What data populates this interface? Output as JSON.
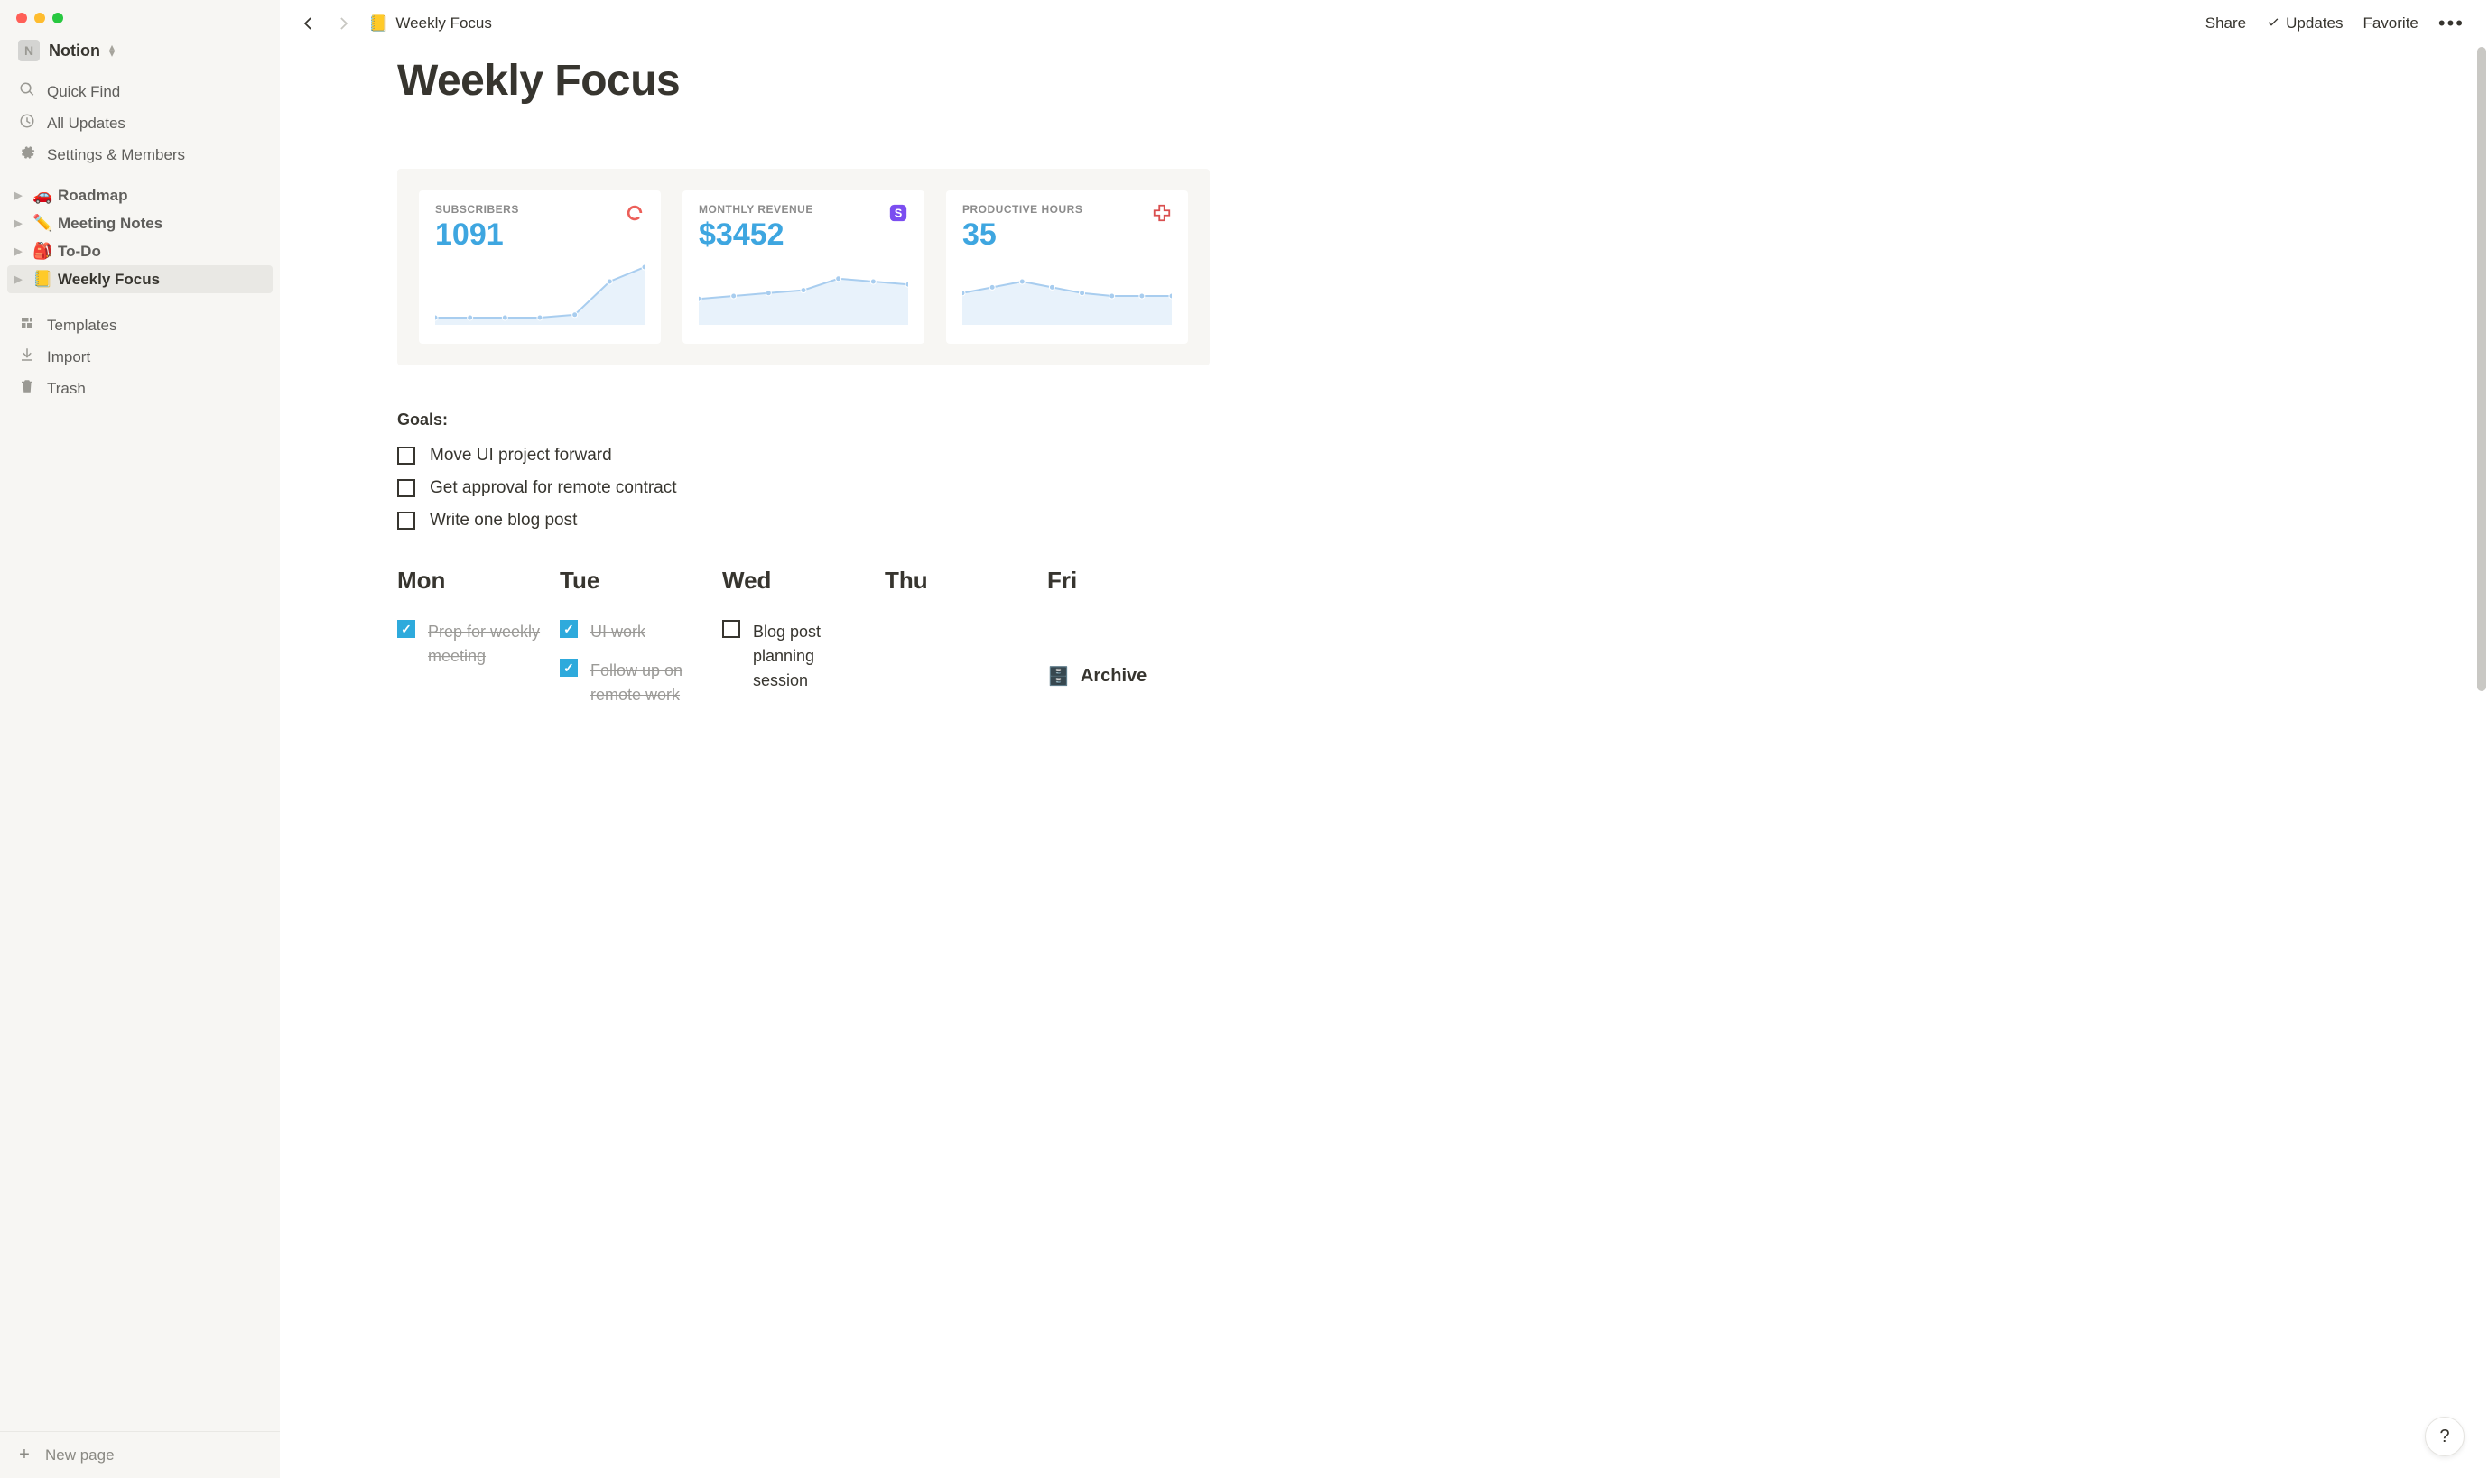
{
  "workspace": {
    "icon_letter": "N",
    "name": "Notion"
  },
  "sidebar": {
    "quick_find": "Quick Find",
    "all_updates": "All Updates",
    "settings": "Settings & Members",
    "pages": [
      {
        "emoji": "🚗",
        "label": "Roadmap"
      },
      {
        "emoji": "✏️",
        "label": "Meeting Notes"
      },
      {
        "emoji": "🎒",
        "label": "To-Do"
      },
      {
        "emoji": "📒",
        "label": "Weekly Focus"
      }
    ],
    "templates": "Templates",
    "import": "Import",
    "trash": "Trash",
    "new_page": "New page"
  },
  "topbar": {
    "breadcrumb_emoji": "📒",
    "breadcrumb_label": "Weekly Focus",
    "share": "Share",
    "updates": "Updates",
    "favorite": "Favorite"
  },
  "page": {
    "title": "Weekly Focus",
    "stats": [
      {
        "label": "SUBSCRIBERS",
        "value": "1091",
        "icon_color": "#ec5f59",
        "points": [
          5,
          5,
          5,
          5,
          7,
          30,
          40
        ]
      },
      {
        "label": "MONTHLY REVENUE",
        "value": "$3452",
        "icon_color": "#7b4ef0",
        "points": [
          18,
          20,
          22,
          24,
          32,
          30,
          28
        ]
      },
      {
        "label": "PRODUCTIVE HOURS",
        "value": "35",
        "icon_color": "#d94f4f",
        "points": [
          22,
          26,
          30,
          26,
          22,
          20,
          20,
          20
        ]
      }
    ],
    "goals_heading": "Goals:",
    "goals": [
      {
        "text": "Move UI project forward",
        "done": false
      },
      {
        "text": "Get approval for remote contract",
        "done": false
      },
      {
        "text": "Write one blog post",
        "done": false
      }
    ],
    "days": [
      {
        "name": "Mon",
        "tasks": [
          {
            "text": "Prep for weekly meeting",
            "done": true
          }
        ]
      },
      {
        "name": "Tue",
        "tasks": [
          {
            "text": "UI work",
            "done": true
          },
          {
            "text": "Follow up on remote work",
            "done": true
          }
        ]
      },
      {
        "name": "Wed",
        "tasks": [
          {
            "text": "Blog post planning session",
            "done": false
          }
        ]
      },
      {
        "name": "Thu",
        "tasks": []
      },
      {
        "name": "Fri",
        "tasks": []
      }
    ],
    "archive_emoji": "🗄️",
    "archive_label": "Archive"
  },
  "help_label": "?",
  "chart_data": [
    {
      "type": "line",
      "title": "SUBSCRIBERS",
      "x": [
        1,
        2,
        3,
        4,
        5,
        6,
        7
      ],
      "values": [
        5,
        5,
        5,
        5,
        7,
        30,
        40
      ],
      "ylim": [
        0,
        50
      ],
      "value_label": "1091"
    },
    {
      "type": "line",
      "title": "MONTHLY REVENUE",
      "x": [
        1,
        2,
        3,
        4,
        5,
        6,
        7
      ],
      "values": [
        18,
        20,
        22,
        24,
        32,
        30,
        28
      ],
      "ylim": [
        0,
        50
      ],
      "value_label": "$3452"
    },
    {
      "type": "line",
      "title": "PRODUCTIVE HOURS",
      "x": [
        1,
        2,
        3,
        4,
        5,
        6,
        7,
        8
      ],
      "values": [
        22,
        26,
        30,
        26,
        22,
        20,
        20,
        20
      ],
      "ylim": [
        0,
        50
      ],
      "value_label": "35"
    }
  ]
}
